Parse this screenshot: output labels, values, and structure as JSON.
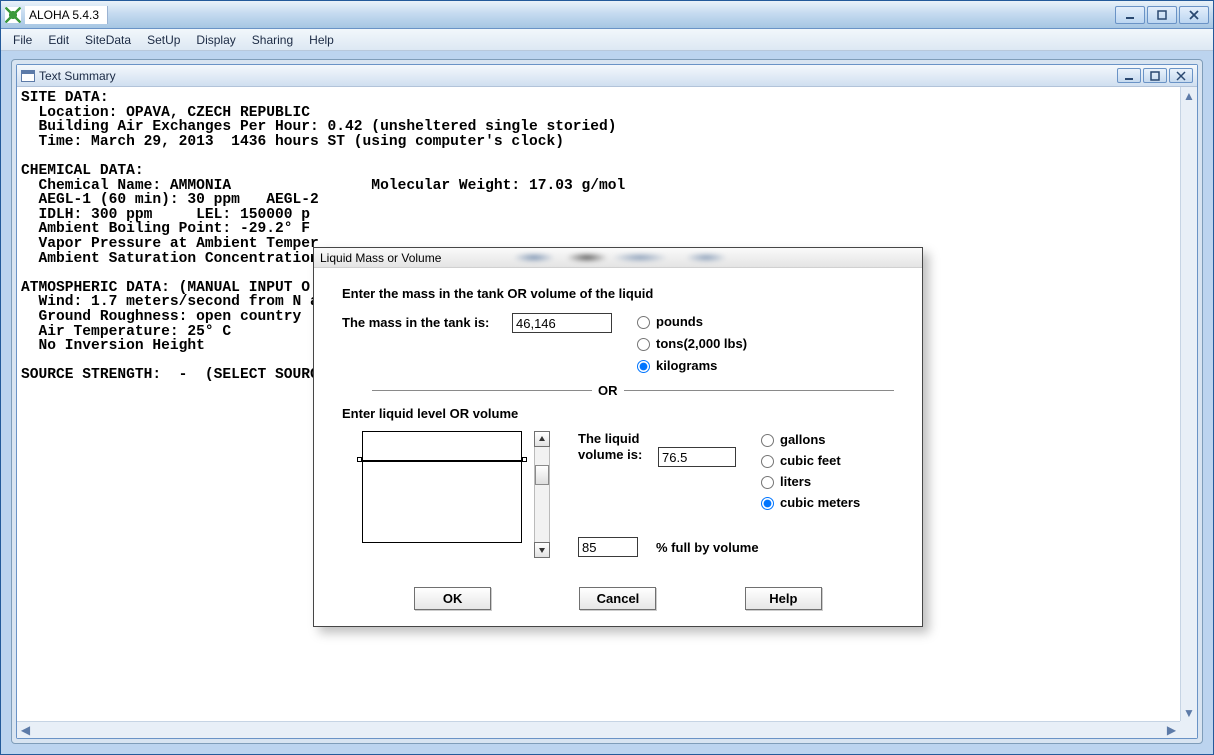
{
  "window": {
    "title": "ALOHA 5.4.3"
  },
  "menu": {
    "file": "File",
    "edit": "Edit",
    "sitedata": "SiteData",
    "setup": "SetUp",
    "display": "Display",
    "sharing": "Sharing",
    "help": "Help"
  },
  "child": {
    "title": "Text Summary"
  },
  "summary_text": "SITE DATA:\n  Location: OPAVA, CZECH REPUBLIC\n  Building Air Exchanges Per Hour: 0.42 (unsheltered single storied)\n  Time: March 29, 2013  1436 hours ST (using computer's clock)\n\nCHEMICAL DATA:\n  Chemical Name: AMMONIA                Molecular Weight: 17.03 g/mol\n  AEGL-1 (60 min): 30 ppm   AEGL-2\n  IDLH: 300 ppm     LEL: 150000 p\n  Ambient Boiling Point: -29.2° F\n  Vapor Pressure at Ambient Temper\n  Ambient Saturation Concentration\n\nATMOSPHERIC DATA: (MANUAL INPUT O\n  Wind: 1.7 meters/second from N a\n  Ground Roughness: open country\n  Air Temperature: 25° C\n  No Inversion Height\n\nSOURCE STRENGTH:  -  (SELECT SOURC",
  "dialog": {
    "title": "Liquid Mass or Volume",
    "prompt1": "Enter the mass in the tank OR volume of the liquid",
    "mass_label": "The mass in the tank is:",
    "mass_value": "46,146",
    "mass_units": {
      "pounds": "pounds",
      "tons": "tons(2,000 lbs)",
      "kilograms": "kilograms"
    },
    "or_text": "OR",
    "section2_label": "Enter liquid level OR volume",
    "vol_label1": "The liquid",
    "vol_label2": "volume is:",
    "vol_value": "76.5",
    "vol_units": {
      "gallons": "gallons",
      "cubic_feet": "cubic feet",
      "liters": "liters",
      "cubic_meters": "cubic meters"
    },
    "pct_value": "85",
    "pct_label": "% full by volume",
    "buttons": {
      "ok": "OK",
      "cancel": "Cancel",
      "help": "Help"
    }
  }
}
